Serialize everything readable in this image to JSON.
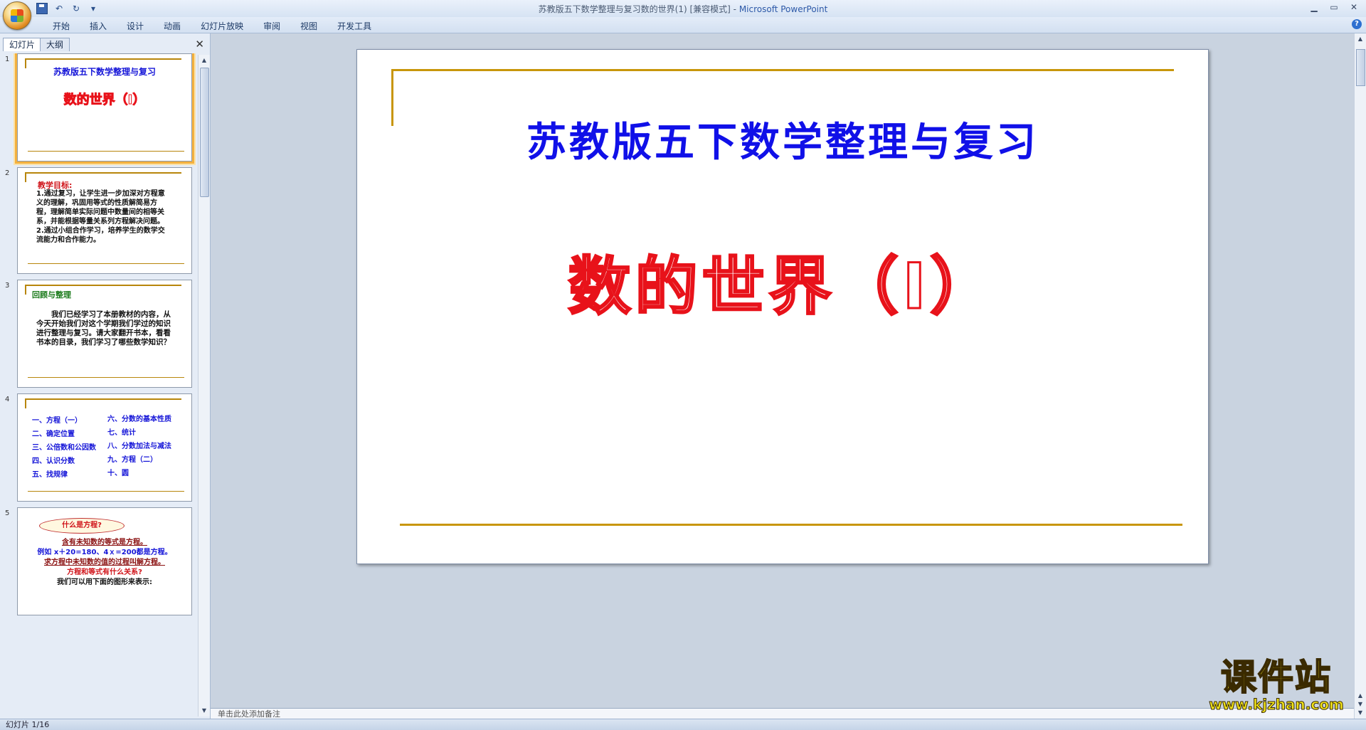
{
  "window": {
    "title_prefix": "苏教版五下数学整理与复习数的世界(1) [兼容模式] - ",
    "app_name": "Microsoft PowerPoint",
    "minimize": "▁",
    "restore": "▭",
    "close": "✕"
  },
  "quick_access": {
    "undo": "↶",
    "redo": "↻",
    "more": "▾"
  },
  "ribbon": {
    "tabs": [
      "开始",
      "插入",
      "设计",
      "动画",
      "幻灯片放映",
      "审阅",
      "视图",
      "开发工具"
    ],
    "help": "?"
  },
  "left_pane": {
    "tabs": {
      "slides": "幻灯片",
      "outline": "大纲"
    },
    "close": "✕",
    "thumbnails": [
      {
        "num": "1",
        "title": "苏教版五下数学整理与复习",
        "subtitle": "数的世界（I）"
      },
      {
        "num": "2",
        "heading": "教学目标:",
        "body": "1.通过复习，让学生进一步加深对方程意义的理解，巩固用等式的性质解简易方程，理解简单实际问题中数量间的相等关系，并能根据等量关系列方程解决问题。\n2.通过小组合作学习，培养学生的数学交流能力和合作能力。"
      },
      {
        "num": "3",
        "heading": "回顾与整理",
        "body": "我们已经学习了本册教材的内容，从今天开始我们对这个学期我们学过的知识进行整理与复习。请大家翻开书本，看看书本的目录，我们学习了哪些数学知识？"
      },
      {
        "num": "4",
        "col1": [
          "一、方程（一）",
          "二、确定位置",
          "三、公倍数和公因数",
          "四、认识分数",
          "五、找规律"
        ],
        "col2": [
          "六、分数的基本性质",
          "七、统计",
          "八、分数加法与减法",
          "九、方程（二）",
          "十、圆"
        ]
      },
      {
        "num": "5",
        "bubble": "什么是方程?",
        "lines": [
          "含有未知数的等式是方程。",
          "例如 x＋20=180、4ｘ=200都是方程。",
          "求方程中未知数的值的过程叫解方程。",
          "方程和等式有什么关系?",
          "我们可以用下面的图形来表示:"
        ]
      }
    ]
  },
  "slide": {
    "title": "苏教版五下数学整理与复习",
    "subtitle": "数的世界（I）"
  },
  "notes": {
    "placeholder": "单击此处添加备注"
  },
  "status": {
    "slide_counter": "幻灯片 1/16"
  },
  "watermark": {
    "main": "课件站",
    "url": "www.kjzhan.com"
  }
}
